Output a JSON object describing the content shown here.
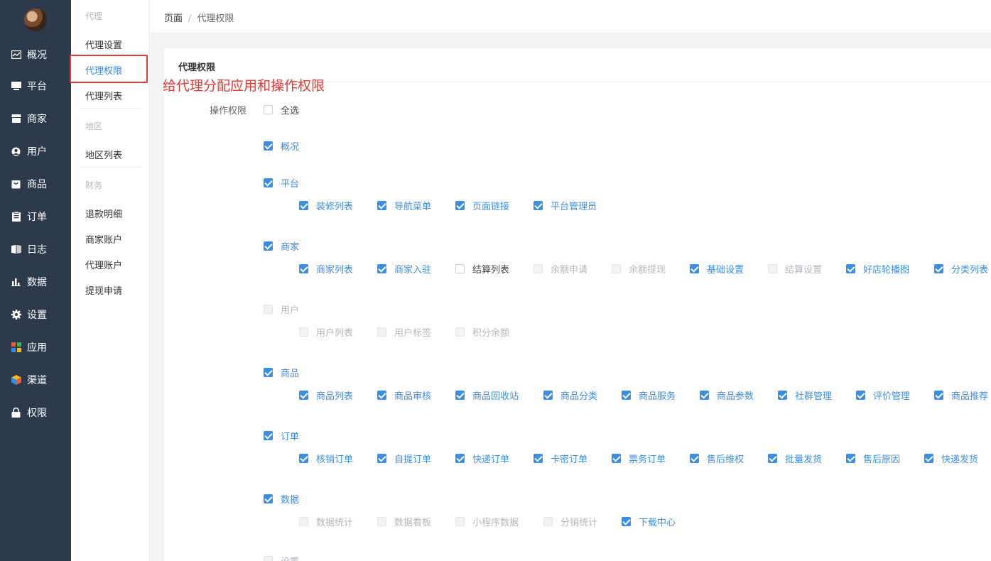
{
  "nav": {
    "items": [
      {
        "label": "概况",
        "icon": "dashboard-icon"
      },
      {
        "label": "平台",
        "icon": "monitor-icon"
      },
      {
        "label": "商家",
        "icon": "store-icon"
      },
      {
        "label": "用户",
        "icon": "user-icon"
      },
      {
        "label": "商品",
        "icon": "bag-icon"
      },
      {
        "label": "订单",
        "icon": "clipboard-icon"
      },
      {
        "label": "日志",
        "icon": "book-icon"
      },
      {
        "label": "数据",
        "icon": "bar-chart-icon"
      },
      {
        "label": "设置",
        "icon": "gear-icon"
      },
      {
        "label": "应用",
        "icon": "apps-icon"
      },
      {
        "label": "渠道",
        "icon": "cube-icon"
      },
      {
        "label": "权限",
        "icon": "lock-icon"
      }
    ]
  },
  "submenu": {
    "group_agent": "代理",
    "agent_settings": "代理设置",
    "agent_permission": "代理权限",
    "agent_list": "代理列表",
    "group_region": "地区",
    "region_list": "地区列表",
    "group_finance": "财务",
    "refund_detail": "退款明细",
    "merchant_account": "商家账户",
    "agent_account": "代理账户",
    "withdraw_apply": "提现申请"
  },
  "annotation": "给代理分配应用和操作权限",
  "breadcrumb": {
    "root": "页面",
    "sep": "/",
    "current": "代理权限"
  },
  "card": {
    "title": "代理权限",
    "field_label": "操作权限"
  },
  "perm": {
    "select_all": "全选",
    "overview": "概况",
    "platform": "平台",
    "platform_children": [
      "装修列表",
      "导航菜单",
      "页面链接",
      "平台管理员"
    ],
    "merchant": "商家",
    "merchant_children": [
      "商家列表",
      "商家入驻",
      "结算列表",
      "余额申请",
      "余额提现",
      "基础设置",
      "结算设置",
      "好店轮播图",
      "分类列表"
    ],
    "user": "用户",
    "user_children": [
      "用户列表",
      "用户标签",
      "积分余额"
    ],
    "goods": "商品",
    "goods_children": [
      "商品列表",
      "商品审核",
      "商品回收站",
      "商品分类",
      "商品服务",
      "商品参数",
      "社群管理",
      "评价管理",
      "商品推荐"
    ],
    "order": "订单",
    "order_children": [
      "核销订单",
      "自提订单",
      "快递订单",
      "卡密订单",
      "票务订单",
      "售后维权",
      "批量发货",
      "售后原因",
      "快递发货"
    ],
    "data": "数据",
    "data_children": [
      "数据统计",
      "数据看板",
      "小程序数据",
      "分销统计",
      "下载中心"
    ],
    "settings": "设置"
  }
}
